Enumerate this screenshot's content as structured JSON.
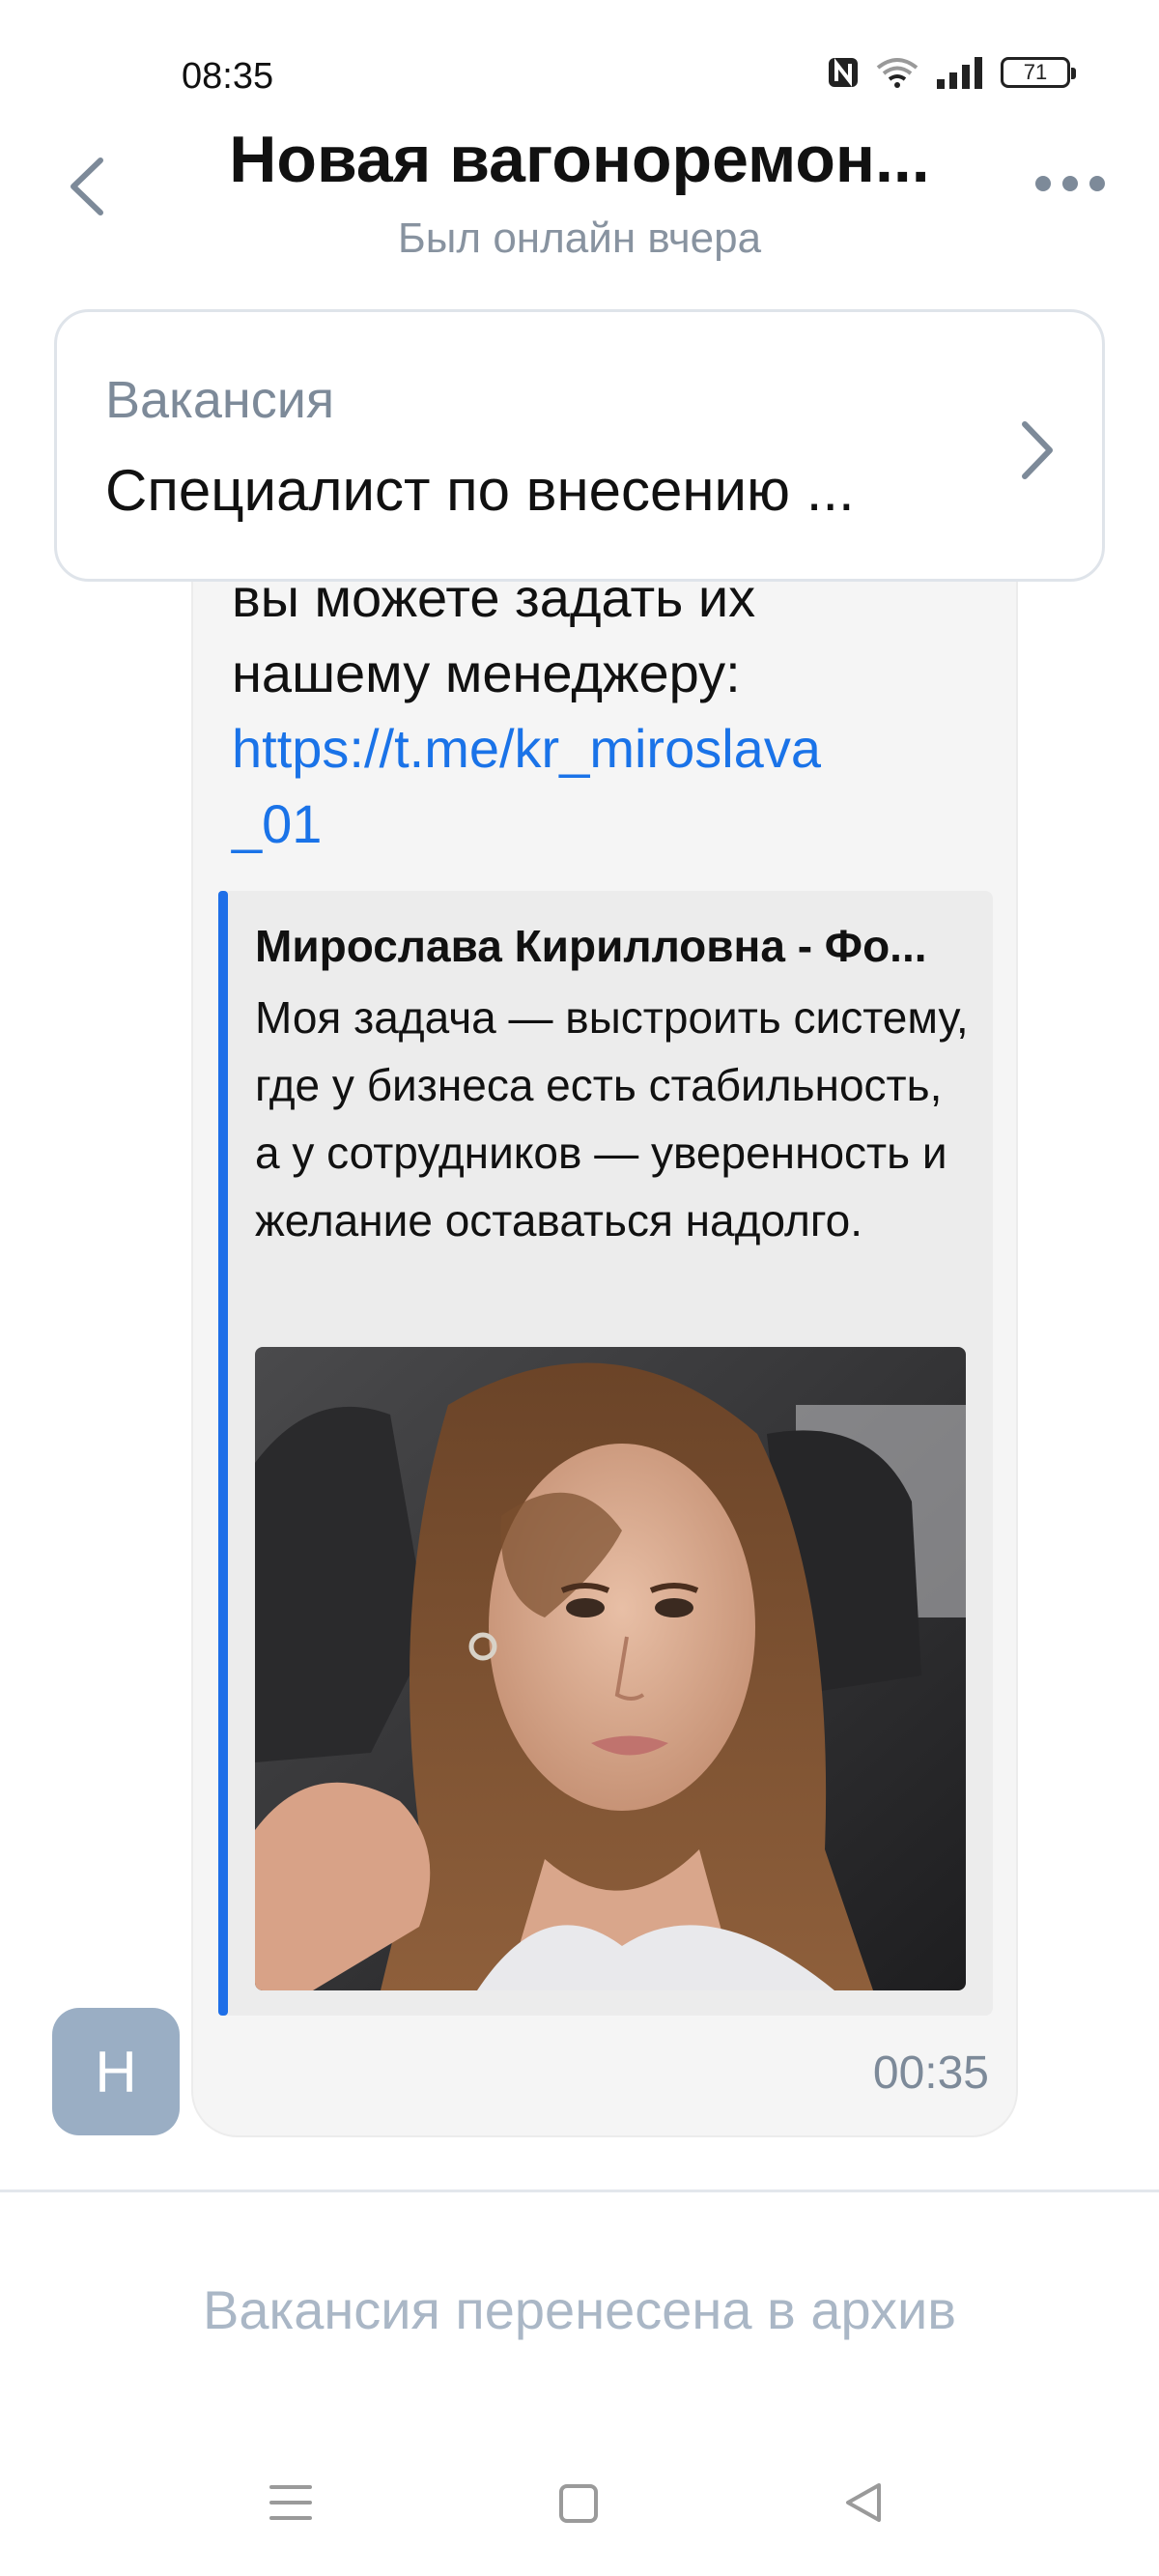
{
  "status_bar": {
    "time": "08:35",
    "battery_level": "71",
    "icons": [
      "nfc-icon",
      "wifi-icon",
      "signal-icon",
      "battery-icon"
    ]
  },
  "header": {
    "title": "Новая вагоноремон...",
    "subtitle": "Был онлайн вчера"
  },
  "vacancy_card": {
    "label": "Вакансия",
    "title": "Специалист по внесению ..."
  },
  "message": {
    "lines": [
      "вы можете задать их",
      "нашему менеджеру:"
    ],
    "link_line1": "https://t.me/kr_miroslava",
    "link_line2": "_01",
    "quote": {
      "title": "Мирослава Кирилловна - Фо...",
      "text": "Моя задача — выстроить систему, где у бизнеса есть стабильность, а у сотрудников — уверенность и желание оставаться надолго."
    },
    "time": "00:35"
  },
  "avatar": {
    "initial": "Н"
  },
  "archive_note": "Вакансия перенесена в архив",
  "colors": {
    "accent": "#1e6fe8",
    "link": "#1a73e8",
    "avatar_bg": "#9aaec4",
    "muted_text": "#7d8a99"
  }
}
